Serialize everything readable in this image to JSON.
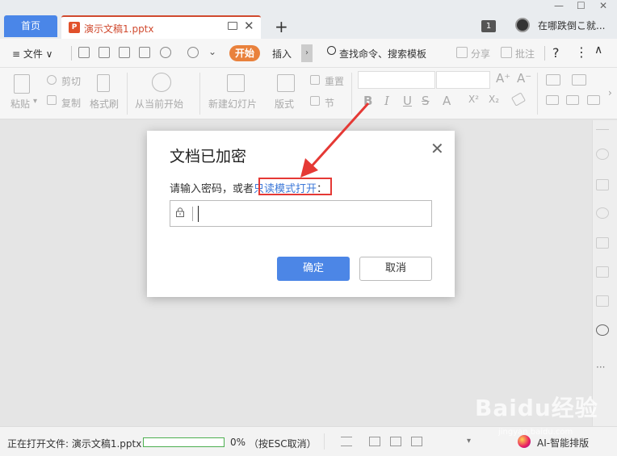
{
  "titlebar": {
    "home_tab": "首页",
    "doc_tab": "演示文稿1.pptx",
    "ppt_glyph": "P",
    "new_tab": "+",
    "notif_count": "1",
    "username": "在哪跌倒こ就...",
    "close_glyph": "✕"
  },
  "menubar": {
    "file": "≡ 文件 ∨",
    "start": "开始",
    "insert": "插入",
    "scroll": "›",
    "search": "查找命令、搜索模板",
    "share": "分享",
    "comment": "批注",
    "help": "?",
    "more": "⋮",
    "collapse": "∧"
  },
  "ribbon": {
    "paste": "粘贴",
    "cut": "剪切",
    "copy": "复制",
    "format_painter": "格式刷",
    "from_current": "从当前开始",
    "new_slide": "新建幻灯片",
    "layout": "版式",
    "reset": "重置",
    "section": "节",
    "bold": "B",
    "italic": "I",
    "underline": "U",
    "strike": "S",
    "shadow": "A",
    "clear": "X²",
    "sub": "X₂"
  },
  "dialog": {
    "title": "文档已加密",
    "prompt": "请输入密码，或者",
    "link": "只读模式打开",
    "colon": "：",
    "ok": "确定",
    "cancel": "取消",
    "close_glyph": "✕"
  },
  "statusbar": {
    "opening": "正在打开文件: 演示文稿1.pptx",
    "progress": 0,
    "percent": "0%",
    "esc": "（按ESC取消）",
    "ai": "AI-智能排版"
  },
  "watermark": {
    "text": "Baidu经验",
    "sub": "jingyan.baidu.com"
  },
  "colors": {
    "accent": "#4a86e8",
    "start_tab": "#e9813c",
    "ppt": "#d04a2f",
    "annotation": "#e53935"
  }
}
